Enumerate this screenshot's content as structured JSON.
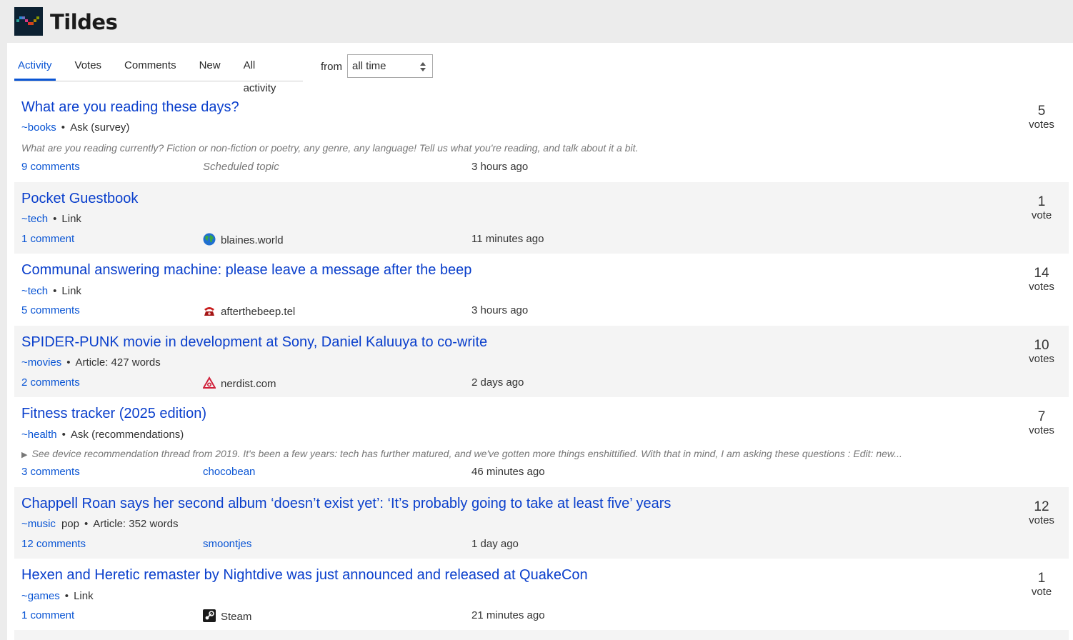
{
  "site": {
    "title": "Tildes"
  },
  "tabs": [
    {
      "label": "Activity",
      "active": true
    },
    {
      "label": "Votes",
      "active": false
    },
    {
      "label": "Comments",
      "active": false
    },
    {
      "label": "New",
      "active": false
    },
    {
      "label": "All activity",
      "active": false
    }
  ],
  "period": {
    "label": "from",
    "value": "all time"
  },
  "topics": [
    {
      "title": "What are you reading these days?",
      "group": "~books",
      "type": "Ask (survey)",
      "excerpt": "What are you reading currently? Fiction or non-fiction or poetry, any genre, any language! Tell us what you're reading, and talk about it a bit.",
      "comments": "9 comments",
      "source": "Scheduled topic",
      "time": "3 hours ago",
      "votes": "5",
      "votes_label": "votes"
    },
    {
      "title": "Pocket Guestbook",
      "group": "~tech",
      "type": "Link",
      "comments": "1 comment",
      "source": "blaines.world",
      "source_icon": "globe-icon",
      "time": "11 minutes ago",
      "votes": "1",
      "votes_label": "vote"
    },
    {
      "title": "Communal answering machine: please leave a message after the beep",
      "group": "~tech",
      "type": "Link",
      "comments": "5 comments",
      "source": "afterthebeep.tel",
      "source_icon": "phone-icon",
      "time": "3 hours ago",
      "votes": "14",
      "votes_label": "votes"
    },
    {
      "title": "SPIDER-PUNK movie in development at Sony, Daniel Kaluuya to co-write",
      "group": "~movies",
      "type": "Article: 427 words",
      "comments": "2 comments",
      "source": "nerdist.com",
      "source_icon": "nerdist-icon",
      "time": "2 days ago",
      "votes": "10",
      "votes_label": "votes"
    },
    {
      "title": "Fitness tracker (2025 edition)",
      "group": "~health",
      "type": "Ask (recommendations)",
      "excerpt": "See device recommendation thread from 2019. It's been a few years: tech has further matured, and we've gotten more things enshittified. With that in mind, I am asking these questions : Edit: new...",
      "comments": "3 comments",
      "source": "chocobean",
      "time": "46 minutes ago",
      "votes": "7",
      "votes_label": "votes"
    },
    {
      "title": "Chappell Roan says her second album ‘doesn’t exist yet’: ‘It’s probably going to take at least five’ years",
      "group": "~music",
      "tag": "pop",
      "type": "Article: 352 words",
      "comments": "12 comments",
      "source": "smoontjes",
      "time": "1 day ago",
      "votes": "12",
      "votes_label": "votes"
    },
    {
      "title": "Hexen and Heretic remaster by Nightdive was just announced and released at QuakeCon",
      "group": "~games",
      "type": "Link",
      "comments": "1 comment",
      "source": "Steam",
      "source_icon": "steam-icon",
      "time": "21 minutes ago",
      "votes": "1",
      "votes_label": "vote"
    }
  ]
}
